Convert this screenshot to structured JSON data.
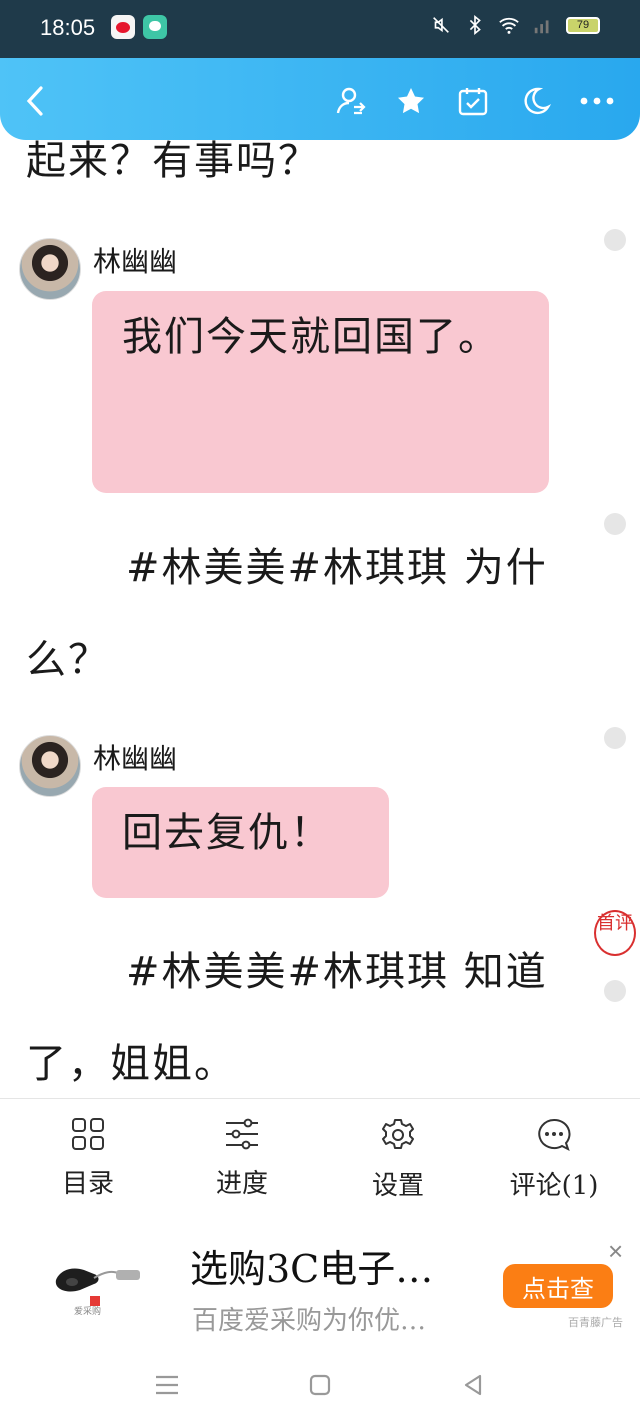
{
  "status_bar": {
    "time": "18:05",
    "battery": "79",
    "apps": [
      "weibo-icon",
      "chat-app-icon"
    ],
    "indicators": [
      "mute-icon",
      "bluetooth-icon",
      "wifi-icon",
      "signal-icon"
    ]
  },
  "nav": {
    "back": "back-icon",
    "actions": [
      "user-switch-icon",
      "star-icon",
      "calendar-check-icon",
      "moon-icon",
      "more-icon"
    ]
  },
  "content": {
    "lines": [
      "起来？有事吗？",
      "#林美美#林琪琪 为什么？",
      "#林美美#林琪琪 知道了，姐姐。"
    ],
    "messages": [
      {
        "speaker": "林幽幽",
        "text": "我们今天就回国了。"
      },
      {
        "speaker": "林幽幽",
        "text": "回去复仇！"
      }
    ],
    "first_comment_badge": "首评"
  },
  "toolbar": {
    "items": [
      {
        "label": "目录",
        "icon": "grid-icon"
      },
      {
        "label": "进度",
        "icon": "sliders-icon"
      },
      {
        "label": "设置",
        "icon": "gear-icon"
      },
      {
        "label": "评论(1)",
        "icon": "comment-icon"
      }
    ]
  },
  "ad": {
    "title": "选购3C电子…",
    "desc": "百度爱采购为你优…",
    "cta": "点击查",
    "source": "百青藤广告",
    "brand_caption": "爱采购",
    "close": "×"
  },
  "colors": {
    "nav_gradient_start": "#4fc3f7",
    "nav_gradient_end": "#29a8ee",
    "bubble": "#f9c8d1",
    "cta": "#fb7e14",
    "status_bar": "#1f3a4a"
  }
}
